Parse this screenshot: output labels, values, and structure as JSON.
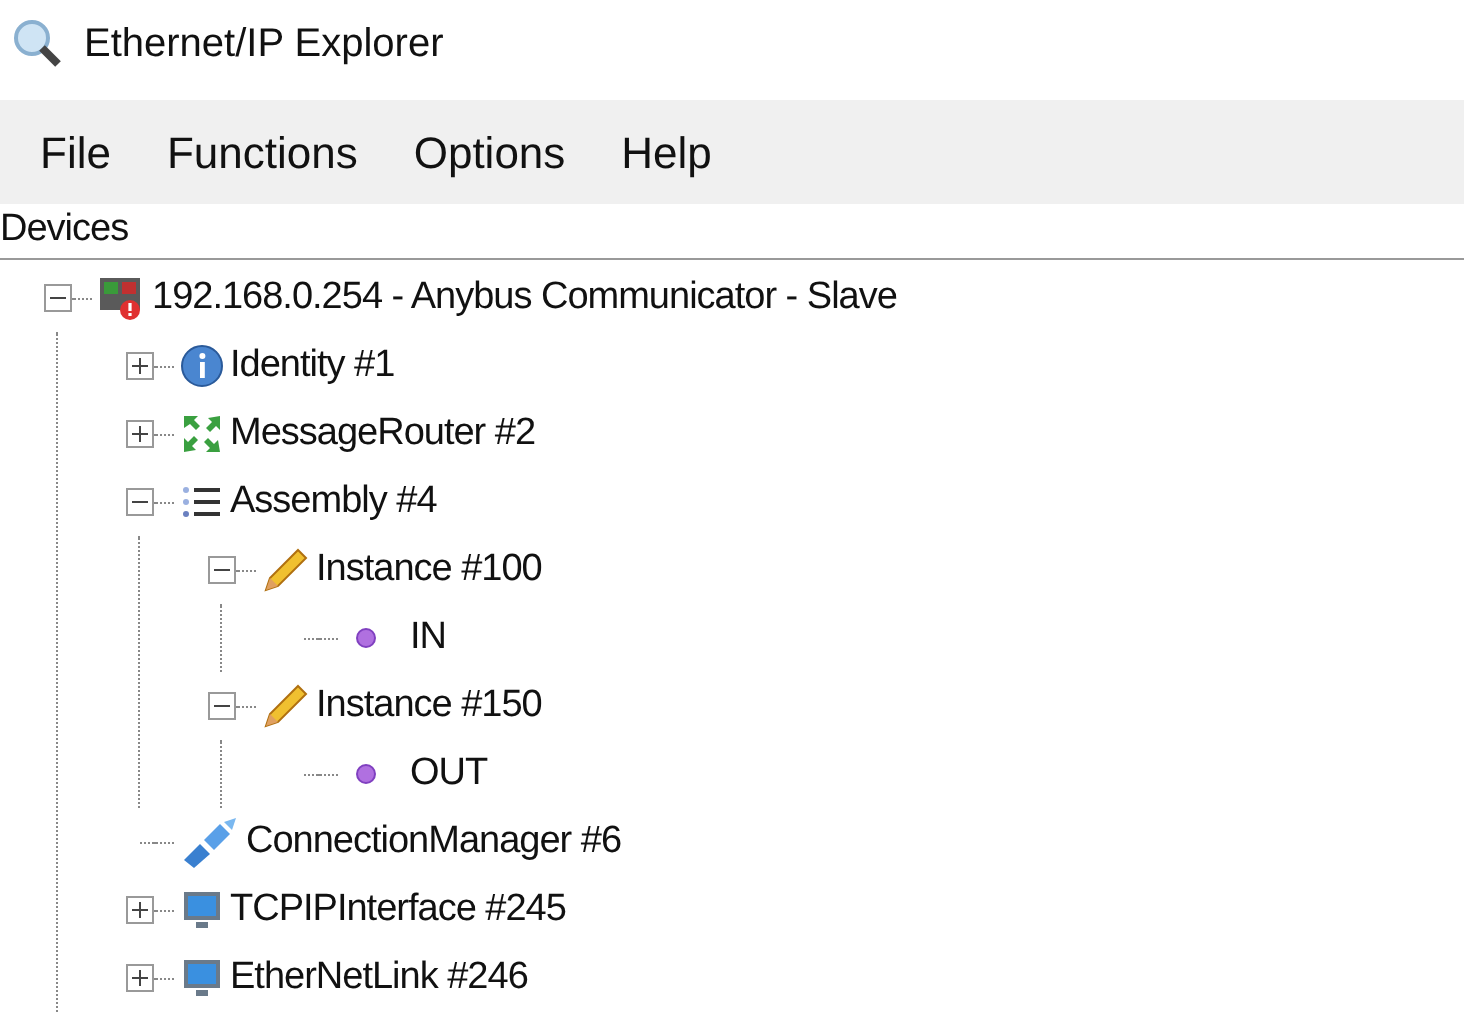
{
  "window": {
    "title": "Ethernet/IP Explorer"
  },
  "menu": [
    "File",
    "Functions",
    "Options",
    "Help"
  ],
  "panel": {
    "title": "Devices"
  },
  "tree": [
    {
      "kind": "device",
      "label": "192.168.0.254 - Anybus Communicator - Slave",
      "expanded": true,
      "children": [
        {
          "kind": "info",
          "label": "Identity #1",
          "expanded": false
        },
        {
          "kind": "router",
          "label": "MessageRouter #2",
          "expanded": false
        },
        {
          "kind": "assembly",
          "label": "Assembly #4",
          "expanded": true,
          "children": [
            {
              "kind": "pencil",
              "label": "Instance #100",
              "expanded": true,
              "children": [
                {
                  "kind": "dot",
                  "label": "IN"
                }
              ]
            },
            {
              "kind": "pencil",
              "label": "Instance #150",
              "expanded": true,
              "children": [
                {
                  "kind": "dot",
                  "label": "OUT"
                }
              ]
            }
          ]
        },
        {
          "kind": "connection",
          "label": "ConnectionManager #6"
        },
        {
          "kind": "monitor",
          "label": "TCPIPInterface #245",
          "expanded": false
        },
        {
          "kind": "monitor",
          "label": "EtherNetLink #246",
          "expanded": false
        }
      ]
    }
  ]
}
